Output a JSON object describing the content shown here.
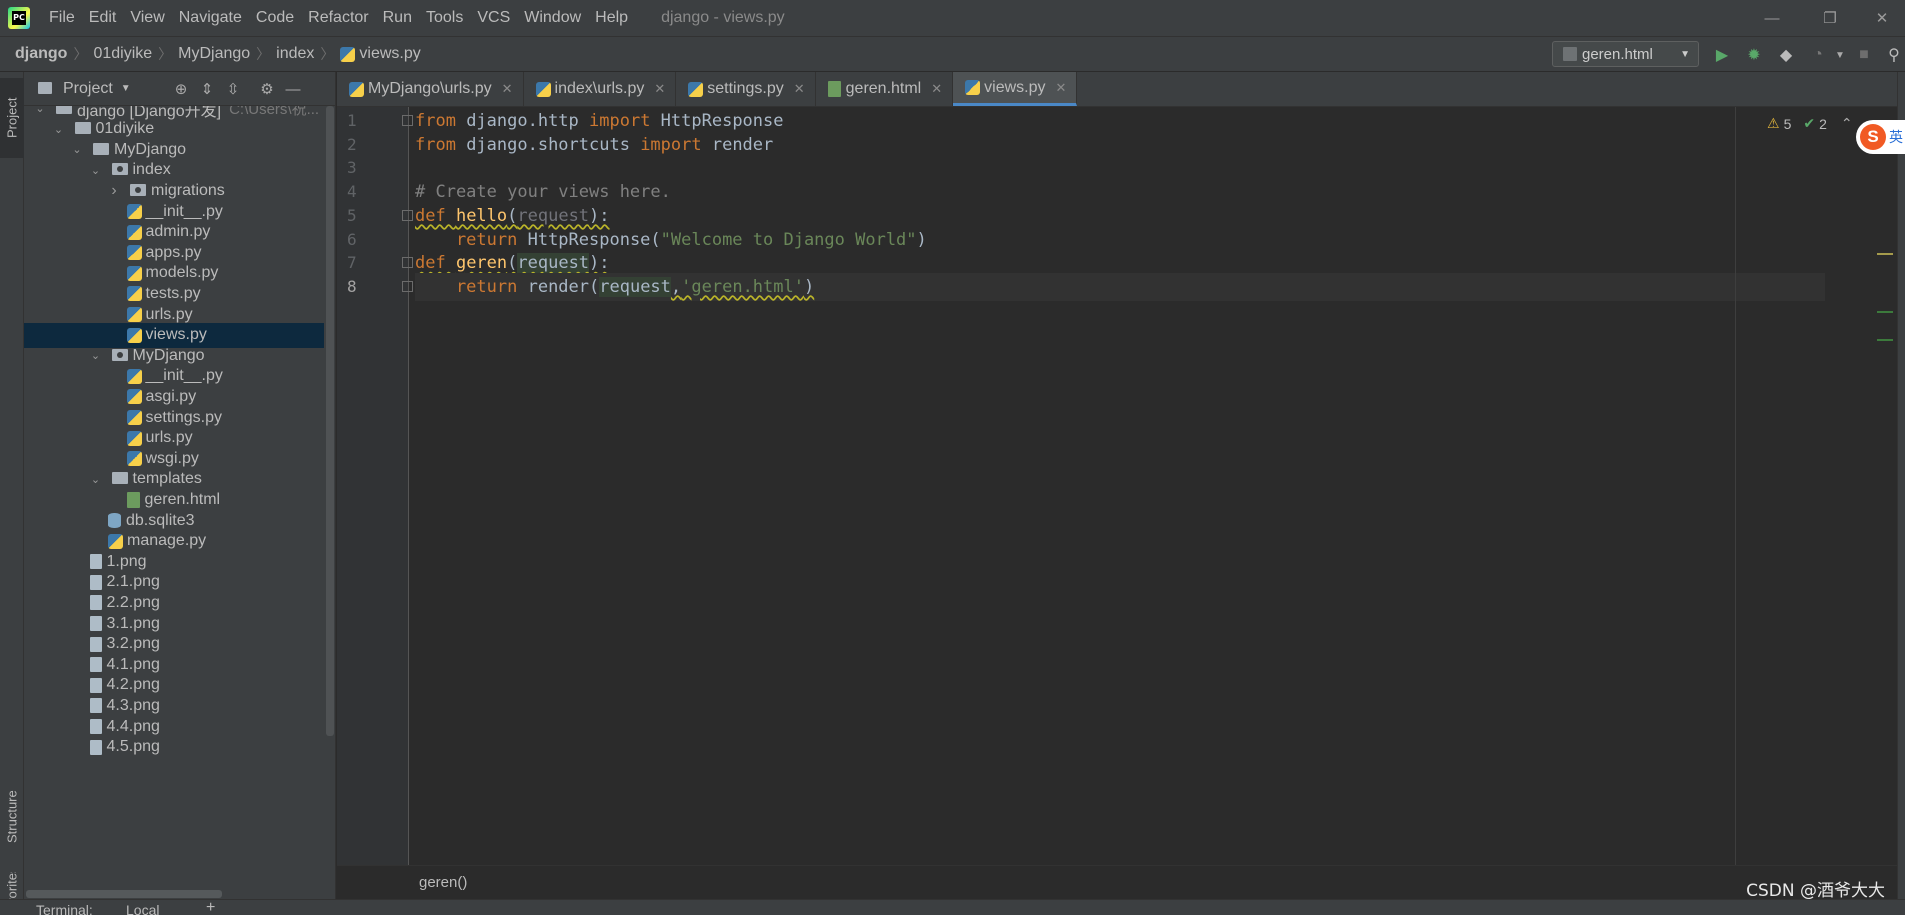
{
  "app": {
    "logo_text": "PC",
    "window_title": "django - views.py"
  },
  "menu": [
    "File",
    "Edit",
    "View",
    "Navigate",
    "Code",
    "Refactor",
    "Run",
    "Tools",
    "VCS",
    "Window",
    "Help"
  ],
  "window_controls": {
    "minimize": "—",
    "restore": "❐",
    "close": "✕"
  },
  "breadcrumb": [
    "django",
    "01diyike",
    "MyDjango",
    "index",
    "views.py"
  ],
  "run_config": {
    "label": "geren.html"
  },
  "toolbar_icons": [
    "run-icon",
    "debug-icon",
    "coverage-icon",
    "profile-icon",
    "stop-icon",
    "search-icon"
  ],
  "left_strip": {
    "project_tab": "Project",
    "structure_tab": "Structure",
    "favorites_tab": "Favorites"
  },
  "project_panel": {
    "title": "Project",
    "tree": [
      {
        "label": "django [Django开发]",
        "hint": "C:\\Users\\祝...",
        "indent": 0,
        "icon": "folder",
        "arrow": "down"
      },
      {
        "label": "01diyike",
        "indent": 1,
        "icon": "folder",
        "arrow": "down"
      },
      {
        "label": "MyDjango",
        "indent": 2,
        "icon": "folder",
        "arrow": "down"
      },
      {
        "label": "index",
        "indent": 3,
        "icon": "package",
        "arrow": "down"
      },
      {
        "label": "migrations",
        "indent": 4,
        "icon": "package",
        "arrow": "right"
      },
      {
        "label": "__init__.py",
        "indent": 5,
        "icon": "py"
      },
      {
        "label": "admin.py",
        "indent": 5,
        "icon": "py"
      },
      {
        "label": "apps.py",
        "indent": 5,
        "icon": "py"
      },
      {
        "label": "models.py",
        "indent": 5,
        "icon": "py"
      },
      {
        "label": "tests.py",
        "indent": 5,
        "icon": "py"
      },
      {
        "label": "urls.py",
        "indent": 5,
        "icon": "py"
      },
      {
        "label": "views.py",
        "indent": 5,
        "icon": "py",
        "selected": true
      },
      {
        "label": "MyDjango",
        "indent": 3,
        "icon": "package",
        "arrow": "down"
      },
      {
        "label": "__init__.py",
        "indent": 5,
        "icon": "py"
      },
      {
        "label": "asgi.py",
        "indent": 5,
        "icon": "py"
      },
      {
        "label": "settings.py",
        "indent": 5,
        "icon": "py"
      },
      {
        "label": "urls.py",
        "indent": 5,
        "icon": "py"
      },
      {
        "label": "wsgi.py",
        "indent": 5,
        "icon": "py"
      },
      {
        "label": "templates",
        "indent": 3,
        "icon": "template",
        "arrow": "down"
      },
      {
        "label": "geren.html",
        "indent": 5,
        "icon": "html"
      },
      {
        "label": "db.sqlite3",
        "indent": 4,
        "icon": "db"
      },
      {
        "label": "manage.py",
        "indent": 4,
        "icon": "py"
      },
      {
        "label": "1.png",
        "indent": 3,
        "icon": "png"
      },
      {
        "label": "2.1.png",
        "indent": 3,
        "icon": "png"
      },
      {
        "label": "2.2.png",
        "indent": 3,
        "icon": "png"
      },
      {
        "label": "3.1.png",
        "indent": 3,
        "icon": "png"
      },
      {
        "label": "3.2.png",
        "indent": 3,
        "icon": "png"
      },
      {
        "label": "4.1.png",
        "indent": 3,
        "icon": "png"
      },
      {
        "label": "4.2.png",
        "indent": 3,
        "icon": "png"
      },
      {
        "label": "4.3.png",
        "indent": 3,
        "icon": "png"
      },
      {
        "label": "4.4.png",
        "indent": 3,
        "icon": "png"
      },
      {
        "label": "4.5.png",
        "indent": 3,
        "icon": "png"
      }
    ]
  },
  "editor_tabs": [
    {
      "label": "MyDjango\\urls.py",
      "icon": "py",
      "active": false
    },
    {
      "label": "index\\urls.py",
      "icon": "py",
      "active": false
    },
    {
      "label": "settings.py",
      "icon": "py",
      "active": false
    },
    {
      "label": "geren.html",
      "icon": "html",
      "active": false
    },
    {
      "label": "views.py",
      "icon": "py",
      "active": true
    }
  ],
  "editor": {
    "current_line": 8,
    "lines": [
      [
        {
          "t": "from ",
          "c": "kw"
        },
        {
          "t": "django.http ",
          "c": "plain"
        },
        {
          "t": "import ",
          "c": "kw"
        },
        {
          "t": "HttpResponse",
          "c": "plain"
        }
      ],
      [
        {
          "t": "from ",
          "c": "kw"
        },
        {
          "t": "django.shortcuts ",
          "c": "plain"
        },
        {
          "t": "import ",
          "c": "kw"
        },
        {
          "t": "render",
          "c": "plain"
        }
      ],
      [],
      [
        {
          "t": "# Create your views here.",
          "c": "cm"
        }
      ],
      [
        {
          "t": "def ",
          "c": "kw warn-ul"
        },
        {
          "t": "hello",
          "c": "fn warn-ul"
        },
        {
          "t": "(",
          "c": "plain warn-ul"
        },
        {
          "t": "request",
          "c": "param-unused warn-ul"
        },
        {
          "t": "):",
          "c": "plain warn-ul"
        }
      ],
      [
        {
          "t": "    return ",
          "c": "kw"
        },
        {
          "t": "HttpResponse(",
          "c": "plain"
        },
        {
          "t": "\"Welcome to Django World\"",
          "c": "str"
        },
        {
          "t": ")",
          "c": "plain"
        }
      ],
      [
        {
          "t": "def ",
          "c": "kw warn-ul"
        },
        {
          "t": "geren",
          "c": "fn warn-ul"
        },
        {
          "t": "(",
          "c": "plain warn-ul"
        },
        {
          "t": "request",
          "c": "plain param-hl warn-ul"
        },
        {
          "t": "):",
          "c": "plain warn-ul"
        }
      ],
      [
        {
          "t": "    return ",
          "c": "kw"
        },
        {
          "t": "render(",
          "c": "plain"
        },
        {
          "t": "request",
          "c": "plain param-hl"
        },
        {
          "t": ",",
          "c": "plain warn-ul"
        },
        {
          "t": "'geren.html'",
          "c": "str warn-ul"
        },
        {
          "t": ")",
          "c": "plain warn-ul"
        }
      ]
    ],
    "inspections": {
      "warnings": "5",
      "weak_warnings": "2"
    },
    "footer_breadcrumb": "geren()"
  },
  "bottom_bar": {
    "terminal_label": "Terminal:",
    "terminal_tab": "Local",
    "add": "+"
  },
  "ime_badge": {
    "logo": "S",
    "mode": "英"
  },
  "watermark": "CSDN @酒爷大大",
  "colors": {
    "keyword": "#cc7832",
    "function": "#ffc66d",
    "string": "#6a8759",
    "comment": "#808080",
    "selection": "#0d293e",
    "tab_accent": "#4a88c7"
  }
}
